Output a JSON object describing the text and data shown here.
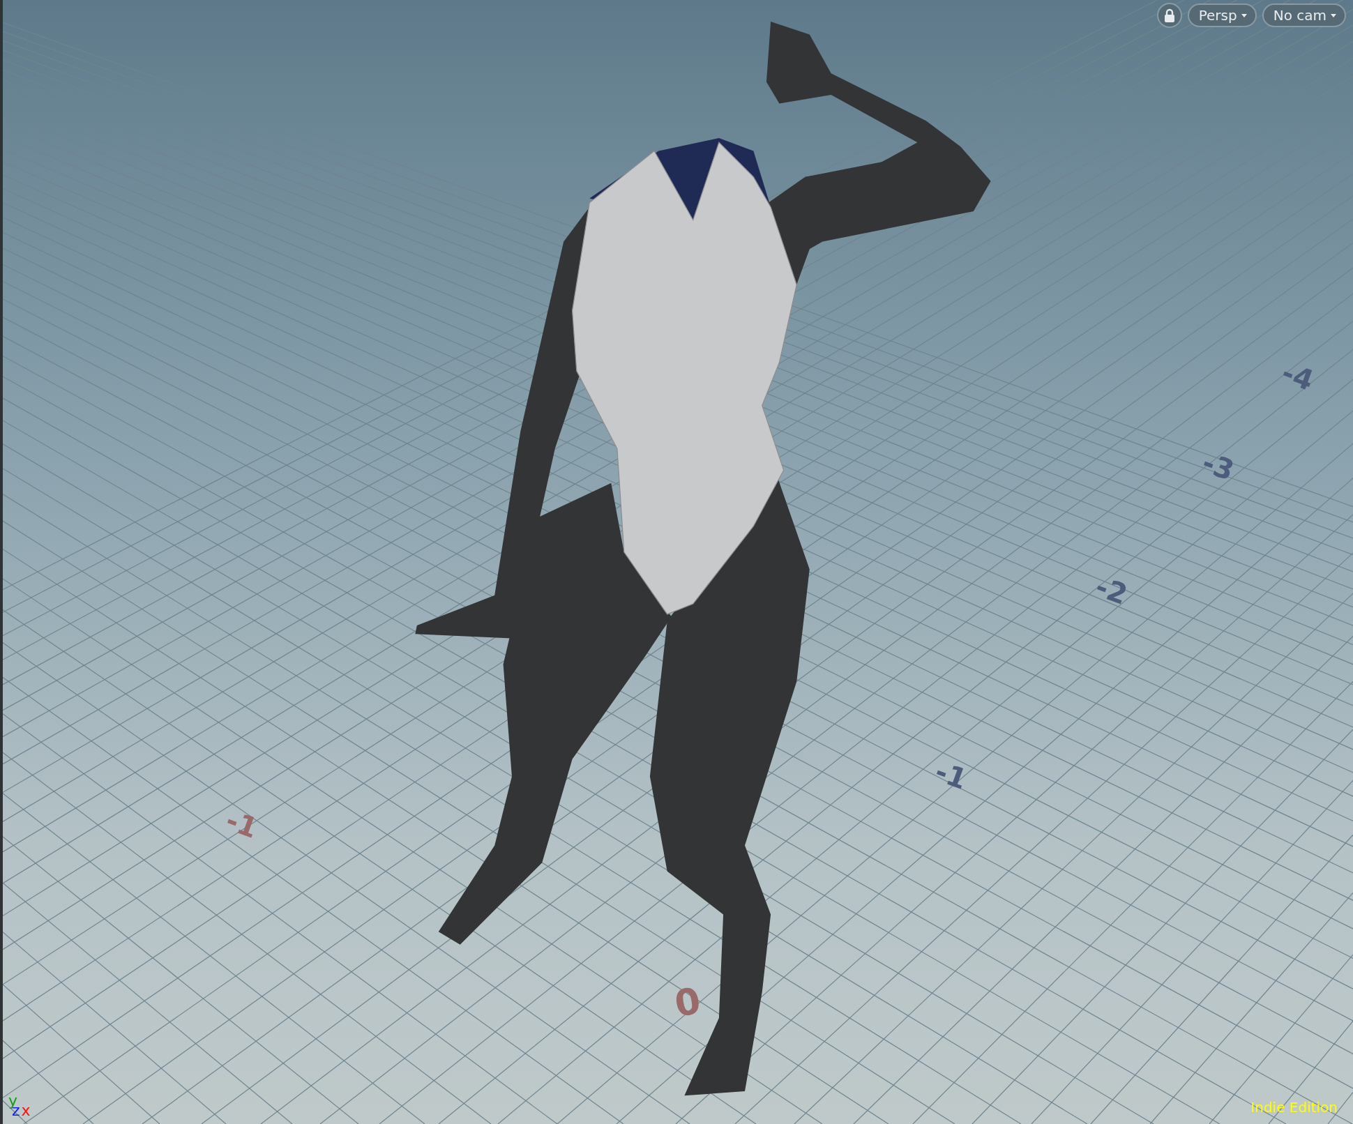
{
  "viewport": {
    "lock": {
      "locked": true
    },
    "view_menu": "Persp",
    "camera_menu": "No cam",
    "grid_labels": [
      {
        "text": "-1",
        "kind": "x"
      },
      {
        "text": "0",
        "kind": "x"
      },
      {
        "text": "-1",
        "kind": "z"
      },
      {
        "text": "-2",
        "kind": "z"
      },
      {
        "text": "-3",
        "kind": "z"
      },
      {
        "text": "-4",
        "kind": "z"
      }
    ],
    "axis_gizmo": [
      {
        "text": "y",
        "kind": "y"
      },
      {
        "text": "z",
        "kind": "z"
      },
      {
        "text": "x",
        "kind": "x"
      }
    ],
    "edition": "Indie Edition"
  }
}
